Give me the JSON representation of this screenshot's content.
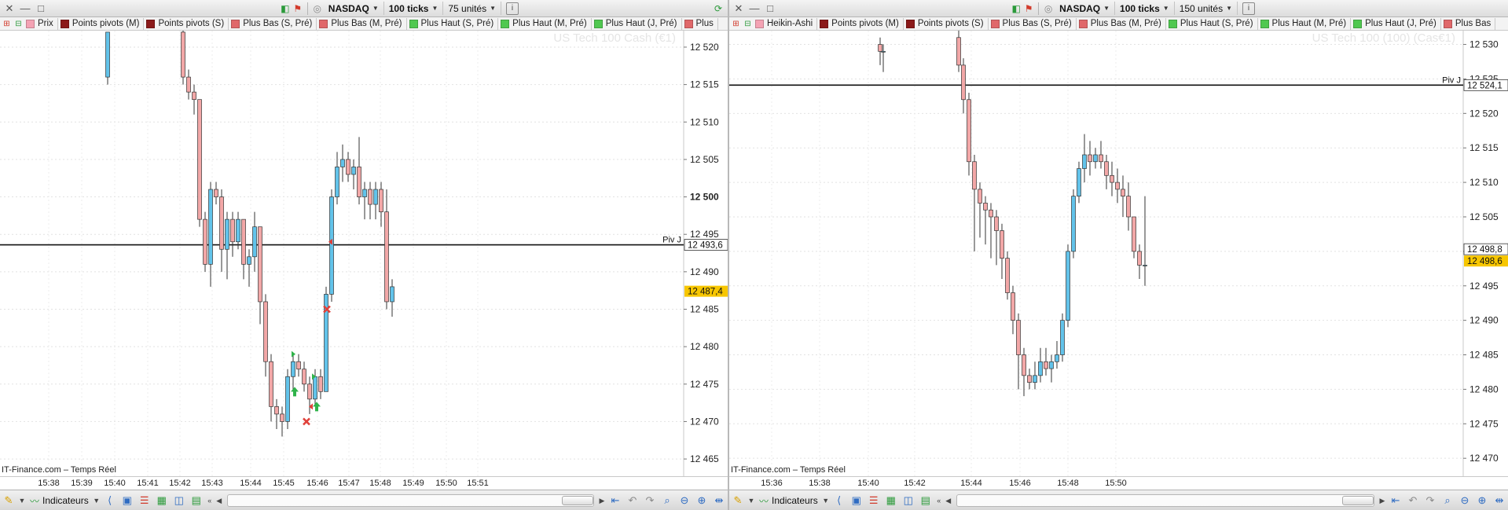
{
  "left": {
    "symbol": "NASDAQ",
    "period": "100 ticks",
    "units": "75 unités",
    "indicators": [
      {
        "label": "Prix",
        "color": "#f4a3b4"
      },
      {
        "label": "Points pivots (M)",
        "color": "#8b1a1a"
      },
      {
        "label": "Points pivots (S)",
        "color": "#8b1a1a"
      },
      {
        "label": "Plus Bas (S, Pré)",
        "color": "#e0686a"
      },
      {
        "label": "Plus Bas (M, Pré)",
        "color": "#e0686a"
      },
      {
        "label": "Plus Haut (S, Pré)",
        "color": "#50c850"
      },
      {
        "label": "Plus Haut (M, Pré)",
        "color": "#50c850"
      },
      {
        "label": "Plus Haut (J, Pré)",
        "color": "#50c850"
      },
      {
        "label": "Plus",
        "color": "#e0686a"
      }
    ],
    "watermark": "US Tech 100 Cash (€1)",
    "source": "IT-Finance.com – Temps Réel",
    "xlabels": [
      "15:38",
      "15:39",
      "15:40",
      "15:41",
      "15:42",
      "15:43",
      "15:44",
      "15:45",
      "15:46",
      "15:47",
      "15:48",
      "15:49",
      "15:50",
      "15:51"
    ],
    "pivot_label": "Piv J",
    "pivot_tag": "12 493,6",
    "price_tag": "12 487,4",
    "indicateurs_label": "Indicateurs"
  },
  "right": {
    "symbol": "NASDAQ",
    "period": "100 ticks",
    "units": "150 unités",
    "indicators": [
      {
        "label": "Heikin-Ashi",
        "color": "#f4a3b4"
      },
      {
        "label": "Points pivots (M)",
        "color": "#8b1a1a"
      },
      {
        "label": "Points pivots (S)",
        "color": "#8b1a1a"
      },
      {
        "label": "Plus Bas (S, Pré)",
        "color": "#e0686a"
      },
      {
        "label": "Plus Bas (M, Pré)",
        "color": "#e0686a"
      },
      {
        "label": "Plus Haut (S, Pré)",
        "color": "#50c850"
      },
      {
        "label": "Plus Haut (M, Pré)",
        "color": "#50c850"
      },
      {
        "label": "Plus Haut (J, Pré)",
        "color": "#50c850"
      },
      {
        "label": "Plus Bas",
        "color": "#e0686a"
      }
    ],
    "watermark": "US Tech 100 (100) (Cas€1)",
    "source": "IT-Finance.com – Temps Réel",
    "xlabels": [
      "15:36",
      "15:38",
      "15:40",
      "15:42",
      "15:44",
      "15:46",
      "15:48",
      "15:50"
    ],
    "pivot_label": "Piv J",
    "pivot_tag": "12 524,1",
    "price_tag": "12 498,6",
    "price_tag2": "12 498,8",
    "indicateurs_label": "Indicateurs"
  },
  "chart_data": [
    {
      "type": "candlestick",
      "title": "NASDAQ 100 ticks",
      "xlabel": "",
      "ylabel": "",
      "y_ticks": [
        12520,
        12515,
        12510,
        12505,
        12500,
        12495,
        12490,
        12485,
        12480,
        12475,
        12470,
        12465
      ],
      "ylim": [
        12462.7,
        12522.2
      ],
      "pivot_line": 12493.6,
      "last_price": 12487.4,
      "up_color": "#62c3ea",
      "down_color": "#f2a7a7",
      "candles": [
        {
          "x": 137,
          "o": 12516,
          "c": 12522,
          "h": 12522,
          "l": 12515
        },
        {
          "x": 233,
          "o": 12522,
          "c": 12516,
          "h": 12523,
          "l": 12515
        },
        {
          "x": 240,
          "o": 12516,
          "c": 12514,
          "h": 12517,
          "l": 12513
        },
        {
          "x": 247,
          "o": 12514,
          "c": 12513,
          "h": 12515,
          "l": 12511
        },
        {
          "x": 254,
          "o": 12513,
          "c": 12497,
          "h": 12513,
          "l": 12496
        },
        {
          "x": 261,
          "o": 12497,
          "c": 12491,
          "h": 12498,
          "l": 12490
        },
        {
          "x": 268,
          "o": 12491,
          "c": 12501,
          "h": 12502,
          "l": 12488
        },
        {
          "x": 275,
          "o": 12501,
          "c": 12500,
          "h": 12502,
          "l": 12499
        },
        {
          "x": 282,
          "o": 12500,
          "c": 12493,
          "h": 12501,
          "l": 12490
        },
        {
          "x": 289,
          "o": 12493,
          "c": 12497,
          "h": 12498,
          "l": 12489
        },
        {
          "x": 296,
          "o": 12497,
          "c": 12494,
          "h": 12498,
          "l": 12492
        },
        {
          "x": 303,
          "o": 12494,
          "c": 12497,
          "h": 12498,
          "l": 12493
        },
        {
          "x": 310,
          "o": 12497,
          "c": 12491,
          "h": 12497,
          "l": 12489
        },
        {
          "x": 317,
          "o": 12491,
          "c": 12492,
          "h": 12493,
          "l": 12488
        },
        {
          "x": 324,
          "o": 12492,
          "c": 12496,
          "h": 12498,
          "l": 12490
        },
        {
          "x": 331,
          "o": 12496,
          "c": 12486,
          "h": 12496,
          "l": 12483
        },
        {
          "x": 338,
          "o": 12486,
          "c": 12478,
          "h": 12487,
          "l": 12476
        },
        {
          "x": 345,
          "o": 12478,
          "c": 12472,
          "h": 12479,
          "l": 12470
        },
        {
          "x": 352,
          "o": 12472,
          "c": 12471,
          "h": 12473,
          "l": 12469
        },
        {
          "x": 359,
          "o": 12471,
          "c": 12470,
          "h": 12472,
          "l": 12468
        },
        {
          "x": 366,
          "o": 12470,
          "c": 12476,
          "h": 12477,
          "l": 12469
        },
        {
          "x": 373,
          "o": 12476,
          "c": 12478,
          "h": 12479,
          "l": 12474
        },
        {
          "x": 380,
          "o": 12478,
          "c": 12477,
          "h": 12479,
          "l": 12476
        },
        {
          "x": 387,
          "o": 12477,
          "c": 12475,
          "h": 12478,
          "l": 12474
        },
        {
          "x": 394,
          "o": 12475,
          "c": 12473,
          "h": 12476,
          "l": 12471
        },
        {
          "x": 401,
          "o": 12473,
          "c": 12476,
          "h": 12477,
          "l": 12472
        },
        {
          "x": 408,
          "o": 12476,
          "c": 12474,
          "h": 12477,
          "l": 12473
        },
        {
          "x": 415,
          "o": 12474,
          "c": 12487,
          "h": 12488,
          "l": 12474
        },
        {
          "x": 422,
          "o": 12487,
          "c": 12500,
          "h": 12501,
          "l": 12486
        },
        {
          "x": 429,
          "o": 12500,
          "c": 12504,
          "h": 12506,
          "l": 12499
        },
        {
          "x": 436,
          "o": 12504,
          "c": 12505,
          "h": 12507,
          "l": 12502
        },
        {
          "x": 443,
          "o": 12505,
          "c": 12503,
          "h": 12506,
          "l": 12502
        },
        {
          "x": 450,
          "o": 12503,
          "c": 12504,
          "h": 12505,
          "l": 12501
        },
        {
          "x": 457,
          "o": 12504,
          "c": 12500,
          "h": 12508,
          "l": 12499
        },
        {
          "x": 464,
          "o": 12500,
          "c": 12501,
          "h": 12502,
          "l": 12497
        },
        {
          "x": 471,
          "o": 12501,
          "c": 12499,
          "h": 12502,
          "l": 12497
        },
        {
          "x": 478,
          "o": 12499,
          "c": 12501,
          "h": 12502,
          "l": 12497
        },
        {
          "x": 485,
          "o": 12501,
          "c": 12498,
          "h": 12502,
          "l": 12496
        },
        {
          "x": 492,
          "o": 12498,
          "c": 12486,
          "h": 12501,
          "l": 12485
        },
        {
          "x": 499,
          "o": 12486,
          "c": 12488,
          "h": 12489,
          "l": 12484
        }
      ],
      "markers": [
        {
          "kind": "up-arrow",
          "x": 375,
          "y": 12474
        },
        {
          "kind": "up-arrow",
          "x": 403,
          "y": 12472
        },
        {
          "kind": "cross",
          "x": 390,
          "y": 12470
        },
        {
          "kind": "cross",
          "x": 416,
          "y": 12485
        },
        {
          "kind": "flag-green",
          "x": 371,
          "y": 12479
        },
        {
          "kind": "flag-green",
          "x": 397,
          "y": 12476
        },
        {
          "kind": "flag-red",
          "x": 393,
          "y": 12472
        },
        {
          "kind": "flag-red",
          "x": 418,
          "y": 12494
        }
      ]
    },
    {
      "type": "candlestick",
      "title": "NASDAQ 100 ticks Heikin-Ashi",
      "xlabel": "",
      "ylabel": "",
      "y_ticks": [
        12530,
        12525,
        12520,
        12515,
        12510,
        12505,
        12500,
        12495,
        12490,
        12485,
        12480,
        12475,
        12470
      ],
      "ylim": [
        12467.4,
        12532.0
      ],
      "pivot_line": 12524.1,
      "last_price": 12498.6,
      "up_color": "#62c3ea",
      "down_color": "#f2a7a7",
      "candles": [
        {
          "x": 1120,
          "o": 12530,
          "c": 12529,
          "h": 12531,
          "l": 12527
        },
        {
          "x": 1124,
          "o": 12529,
          "c": 12529,
          "h": 12530,
          "l": 12526
        },
        {
          "x": 1220,
          "o": 12531,
          "c": 12527,
          "h": 12532,
          "l": 12526
        },
        {
          "x": 1226,
          "o": 12527,
          "c": 12522,
          "h": 12528,
          "l": 12520
        },
        {
          "x": 1233,
          "o": 12522,
          "c": 12513,
          "h": 12523,
          "l": 12511
        },
        {
          "x": 1240,
          "o": 12513,
          "c": 12509,
          "h": 12514,
          "l": 12500
        },
        {
          "x": 1247,
          "o": 12509,
          "c": 12507,
          "h": 12510,
          "l": 12502
        },
        {
          "x": 1254,
          "o": 12507,
          "c": 12506,
          "h": 12508,
          "l": 12501
        },
        {
          "x": 1261,
          "o": 12506,
          "c": 12505,
          "h": 12507,
          "l": 12499
        },
        {
          "x": 1268,
          "o": 12505,
          "c": 12503,
          "h": 12506,
          "l": 12498
        },
        {
          "x": 1275,
          "o": 12503,
          "c": 12499,
          "h": 12504,
          "l": 12496
        },
        {
          "x": 1282,
          "o": 12499,
          "c": 12494,
          "h": 12500,
          "l": 12493
        },
        {
          "x": 1289,
          "o": 12494,
          "c": 12490,
          "h": 12495,
          "l": 12488
        },
        {
          "x": 1296,
          "o": 12490,
          "c": 12485,
          "h": 12491,
          "l": 12480
        },
        {
          "x": 1303,
          "o": 12485,
          "c": 12482,
          "h": 12486,
          "l": 12479
        },
        {
          "x": 1310,
          "o": 12482,
          "c": 12481,
          "h": 12483,
          "l": 12480
        },
        {
          "x": 1317,
          "o": 12481,
          "c": 12482,
          "h": 12484,
          "l": 12480
        },
        {
          "x": 1324,
          "o": 12482,
          "c": 12484,
          "h": 12486,
          "l": 12481
        },
        {
          "x": 1331,
          "o": 12484,
          "c": 12483,
          "h": 12486,
          "l": 12482
        },
        {
          "x": 1338,
          "o": 12483,
          "c": 12484,
          "h": 12485,
          "l": 12481
        },
        {
          "x": 1345,
          "o": 12484,
          "c": 12485,
          "h": 12487,
          "l": 12483
        },
        {
          "x": 1352,
          "o": 12485,
          "c": 12490,
          "h": 12491,
          "l": 12484
        },
        {
          "x": 1359,
          "o": 12490,
          "c": 12500,
          "h": 12501,
          "l": 12489
        },
        {
          "x": 1366,
          "o": 12500,
          "c": 12508,
          "h": 12509,
          "l": 12499
        },
        {
          "x": 1373,
          "o": 12508,
          "c": 12512,
          "h": 12513,
          "l": 12507
        },
        {
          "x": 1380,
          "o": 12512,
          "c": 12514,
          "h": 12517,
          "l": 12510
        },
        {
          "x": 1387,
          "o": 12514,
          "c": 12513,
          "h": 12516,
          "l": 12511
        },
        {
          "x": 1394,
          "o": 12513,
          "c": 12514,
          "h": 12515,
          "l": 12512
        },
        {
          "x": 1401,
          "o": 12514,
          "c": 12513,
          "h": 12516,
          "l": 12512
        },
        {
          "x": 1408,
          "o": 12513,
          "c": 12511,
          "h": 12514,
          "l": 12509
        },
        {
          "x": 1415,
          "o": 12511,
          "c": 12510,
          "h": 12513,
          "l": 12508
        },
        {
          "x": 1422,
          "o": 12510,
          "c": 12509,
          "h": 12512,
          "l": 12507
        },
        {
          "x": 1429,
          "o": 12509,
          "c": 12508,
          "h": 12511,
          "l": 12505
        },
        {
          "x": 1436,
          "o": 12508,
          "c": 12505,
          "h": 12510,
          "l": 12503
        },
        {
          "x": 1443,
          "o": 12505,
          "c": 12500,
          "h": 12505,
          "l": 12499
        },
        {
          "x": 1450,
          "o": 12500,
          "c": 12498,
          "h": 12501,
          "l": 12496
        },
        {
          "x": 1457,
          "o": 12498,
          "c": 12498,
          "h": 12508,
          "l": 12495
        }
      ],
      "markers": []
    }
  ]
}
